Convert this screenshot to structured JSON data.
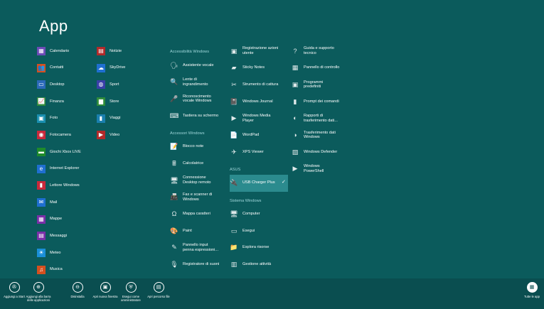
{
  "title": "App",
  "colors": {
    "background": "#0b5b5c",
    "app_bar": "#0a4e50",
    "selected": "#2b8b8e",
    "group_header": "#9fd7db"
  },
  "columns": [
    [
      {
        "type": "app",
        "label": "Calendario",
        "icon": "calendar-icon",
        "color": "#6c4bb6",
        "glyph": "▦"
      },
      {
        "type": "app",
        "label": "Contatti",
        "icon": "people-icon",
        "color": "#d4501f",
        "glyph": "👥"
      },
      {
        "type": "app",
        "label": "Desktop",
        "icon": "desktop-icon",
        "color": "#2a69b9",
        "glyph": "▭"
      },
      {
        "type": "app",
        "label": "Finanza",
        "icon": "finance-icon",
        "color": "#2f8b3a",
        "glyph": "📈"
      },
      {
        "type": "app",
        "label": "Foto",
        "icon": "photo-icon",
        "color": "#1a8fb0",
        "glyph": "▣"
      },
      {
        "type": "app",
        "label": "Fotocamera",
        "icon": "camera-icon",
        "color": "#c8293b",
        "glyph": "◉"
      },
      {
        "type": "app",
        "label": "Giochi Xbox LIVE",
        "icon": "xbox-icon",
        "color": "#1f8b2b",
        "glyph": "▬"
      },
      {
        "type": "app",
        "label": "Internet Explorer",
        "icon": "internet-explorer-icon",
        "color": "#1f6fd0",
        "glyph": "e"
      },
      {
        "type": "app",
        "label": "Lettore Windows",
        "icon": "reader-icon",
        "color": "#c8293b",
        "glyph": "▮"
      },
      {
        "type": "app",
        "label": "Mail",
        "icon": "mail-icon",
        "color": "#1f6fd0",
        "glyph": "✉"
      },
      {
        "type": "app",
        "label": "Mappe",
        "icon": "maps-icon",
        "color": "#7a2fa8",
        "glyph": "▦"
      },
      {
        "type": "app",
        "label": "Messaggi",
        "icon": "messaging-icon",
        "color": "#7a2fa8",
        "glyph": "▤"
      },
      {
        "type": "app",
        "label": "Meteo",
        "icon": "weather-icon",
        "color": "#1a8fd8",
        "glyph": "☀"
      },
      {
        "type": "app",
        "label": "Musica",
        "icon": "music-icon",
        "color": "#d4501f",
        "glyph": "♫"
      }
    ],
    [
      {
        "type": "app",
        "label": "Notizie",
        "icon": "news-icon",
        "color": "#b12a2a",
        "glyph": "▤"
      },
      {
        "type": "app",
        "label": "SkyDrive",
        "icon": "skydrive-icon",
        "color": "#1f6fd0",
        "glyph": "☁"
      },
      {
        "type": "app",
        "label": "Sport",
        "icon": "sport-icon",
        "color": "#3a3fa8",
        "glyph": "◍"
      },
      {
        "type": "app",
        "label": "Store",
        "icon": "store-icon",
        "color": "#2f8b3a",
        "glyph": "▆"
      },
      {
        "type": "app",
        "label": "Viaggi",
        "icon": "travel-icon",
        "color": "#1a7fae",
        "glyph": "▮"
      },
      {
        "type": "app",
        "label": "Video",
        "icon": "video-icon",
        "color": "#b12a2a",
        "glyph": "▶"
      }
    ],
    [
      {
        "type": "group",
        "label": "Accessibilità Windows"
      },
      {
        "type": "tool",
        "label": "Assistente vocale",
        "icon": "narrator-icon",
        "glyph": "🗣"
      },
      {
        "type": "tool",
        "label": "Lente di ingrandimento",
        "icon": "magnifier-icon",
        "glyph": "🔍"
      },
      {
        "type": "tool",
        "label": "Riconoscimento vocale Windows",
        "icon": "speech-recognition-icon",
        "glyph": "🎤"
      },
      {
        "type": "tool",
        "label": "Tastiera su schermo",
        "icon": "keyboard-icon",
        "glyph": "⌨"
      },
      {
        "type": "group",
        "label": "Accessori Windows"
      },
      {
        "type": "tool",
        "label": "Blocco note",
        "icon": "notepad-icon",
        "glyph": "📝"
      },
      {
        "type": "tool",
        "label": "Calcolatrice",
        "icon": "calculator-icon",
        "glyph": "🖩"
      },
      {
        "type": "tool",
        "label": "Connessione Desktop remoto",
        "icon": "remote-desktop-icon",
        "glyph": "🖥"
      },
      {
        "type": "tool",
        "label": "Fax e scanner di Windows",
        "icon": "fax-icon",
        "glyph": "📠"
      },
      {
        "type": "tool",
        "label": "Mappa caratteri",
        "icon": "character-map-icon",
        "glyph": "Ω"
      },
      {
        "type": "tool",
        "label": "Paint",
        "icon": "paint-icon",
        "glyph": "🎨"
      },
      {
        "type": "tool",
        "label": "Pannello input penna espressioni...",
        "icon": "math-input-icon",
        "glyph": "✎"
      },
      {
        "type": "tool",
        "label": "Registratore di suoni",
        "icon": "sound-recorder-icon",
        "glyph": "🎙"
      }
    ],
    [
      {
        "type": "tool",
        "label": "Registrazione azioni utente",
        "icon": "steps-recorder-icon",
        "glyph": "▣"
      },
      {
        "type": "tool",
        "label": "Sticky Notes",
        "icon": "sticky-notes-icon",
        "glyph": "▰"
      },
      {
        "type": "tool",
        "label": "Strumento di cattura",
        "icon": "snipping-tool-icon",
        "glyph": "✂"
      },
      {
        "type": "tool",
        "label": "Windows Journal",
        "icon": "journal-icon",
        "glyph": "📓"
      },
      {
        "type": "tool",
        "label": "Windows Media Player",
        "icon": "media-player-icon",
        "glyph": "▶"
      },
      {
        "type": "tool",
        "label": "WordPad",
        "icon": "wordpad-icon",
        "glyph": "📄"
      },
      {
        "type": "tool",
        "label": "XPS Viewer",
        "icon": "xps-viewer-icon",
        "glyph": "✈"
      },
      {
        "type": "group",
        "label": "ASUS"
      },
      {
        "type": "tool",
        "label": "USB Charger Plus",
        "icon": "usb-charger-icon",
        "glyph": "🔌",
        "selected": true
      },
      {
        "type": "group",
        "label": "Sistema Windows"
      },
      {
        "type": "tool",
        "label": "Computer",
        "icon": "computer-icon",
        "glyph": "🖥"
      },
      {
        "type": "tool",
        "label": "Esegui",
        "icon": "run-icon",
        "glyph": "▭"
      },
      {
        "type": "tool",
        "label": "Esplora risorse",
        "icon": "file-explorer-icon",
        "glyph": "📁"
      },
      {
        "type": "tool",
        "label": "Gestione attività",
        "icon": "task-manager-icon",
        "glyph": "▥"
      }
    ],
    [
      {
        "type": "tool",
        "label": "Guida e supporto tecnico",
        "icon": "help-icon",
        "glyph": "?"
      },
      {
        "type": "tool",
        "label": "Pannello di controllo",
        "icon": "control-panel-icon",
        "glyph": "▦"
      },
      {
        "type": "tool",
        "label": "Programmi predefiniti",
        "icon": "default-programs-icon",
        "glyph": "▣"
      },
      {
        "type": "tool",
        "label": "Prompt dei comandi",
        "icon": "command-prompt-icon",
        "glyph": "▮"
      },
      {
        "type": "tool",
        "label": "Rapporti di trasferimento dati...",
        "icon": "transfer-reports-icon",
        "glyph": "◐"
      },
      {
        "type": "tool",
        "label": "Trasferimento dati Windows",
        "icon": "easy-transfer-icon",
        "glyph": "◑"
      },
      {
        "type": "tool",
        "label": "Windows Defender",
        "icon": "defender-icon",
        "glyph": "▨"
      },
      {
        "type": "tool",
        "label": "Windows PowerShell",
        "icon": "powershell-icon",
        "glyph": "▶"
      }
    ]
  ],
  "app_bar": {
    "buttons": [
      {
        "label": "Aggiungi a Start",
        "icon": "pin-icon",
        "glyph": "✇"
      },
      {
        "label": "Aggiungi alla barra delle applicazioni",
        "icon": "pin-taskbar-icon",
        "glyph": "⊕"
      },
      {
        "label": "Disinstalla",
        "icon": "uninstall-icon",
        "glyph": "⊖"
      },
      {
        "label": "Apri nuova finestra",
        "icon": "new-window-icon",
        "glyph": "▣"
      },
      {
        "label": "Esegui come amministratore",
        "icon": "run-as-admin-icon",
        "glyph": "⛨"
      },
      {
        "label": "Apri percorso file",
        "icon": "open-location-icon",
        "glyph": "▤"
      }
    ],
    "all_apps": {
      "label": "Tutte le app",
      "icon": "all-apps-icon",
      "glyph": "▦"
    }
  }
}
